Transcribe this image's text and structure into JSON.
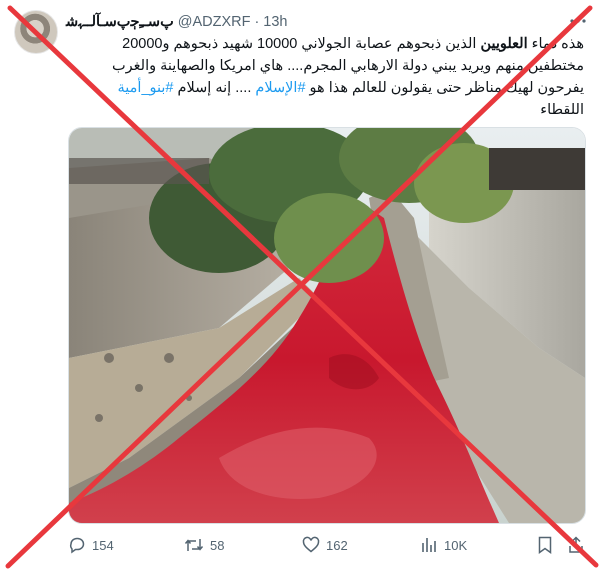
{
  "tweet": {
    "display_name": "ﭖﺳـﹻﭴﭖﺳـﺂﻟــﮩﺷ",
    "handle": "@ADZXRF",
    "separator": "·",
    "time": "13h",
    "text": {
      "l1_a": "هذه دماء ",
      "l1_bold": "العلويين",
      "l1_b": " الذين ذبحوهم عصابة الجولاني 10000 شهيد ذبحوهم و20000",
      "l2": "مختطفين منهم ويريد يبني دولة الارهابي المجرم.... هاي امريكا والصهاينة والغرب",
      "l3_a": "يفرحون لهيك مناظر حتى يقولون للعالم هذا هو ",
      "l3_tag1": "#الإسلام",
      "l3_b": " .... إنه إسلام ",
      "l3_tag2": "#بنو_أمية",
      "l4": "اللقطاء"
    }
  },
  "metrics": {
    "replies": "154",
    "reposts": "58",
    "likes": "162",
    "views": "10K"
  },
  "icons": {
    "reply": "reply-icon",
    "repost": "repost-icon",
    "like": "heart-icon",
    "views": "views-icon",
    "bookmark": "bookmark-icon",
    "share": "share-icon",
    "more": "more-icon"
  },
  "colors": {
    "overlay_x": "#e8383d",
    "link": "#1d9bf0",
    "muted": "#536471",
    "water": "#c9122a"
  }
}
